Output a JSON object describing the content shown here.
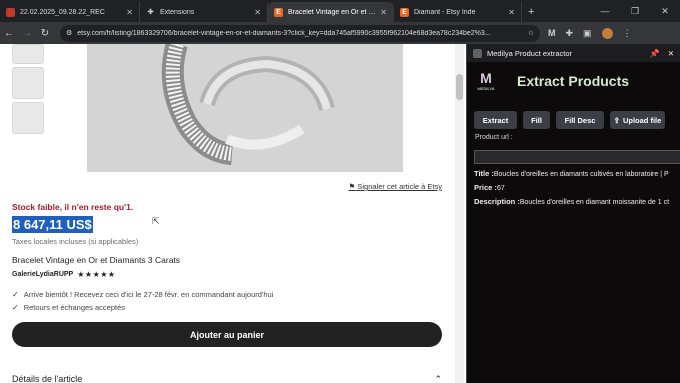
{
  "tabs": [
    {
      "title": "22.02.2025_09.28.22_REC",
      "icon": "video-icon",
      "color": "#c0392b",
      "active": false
    },
    {
      "title": "Extensions",
      "icon": "puzzle-icon",
      "color": "#5f6368",
      "active": false
    },
    {
      "title": "Bracelet Vintage en Or et Diam...",
      "icon": "etsy-icon",
      "color": "#f1641e",
      "active": true
    },
    {
      "title": "Diamant - Etsy Inde",
      "icon": "etsy-icon",
      "color": "#f1641e",
      "active": false
    }
  ],
  "tab_favicon_letters": {
    "etsy": "E"
  },
  "window_controls": {
    "minimize": "—",
    "maximize": "❐",
    "close": "✕"
  },
  "url": "etsy.com/fr/listing/1863329706/bracelet-vintage-en-or-et-diamants-3?click_key=dda745af5990c3955f962104e68d3ea78c234be2%3...",
  "listing": {
    "report_link": "Signaler cet article à Etsy",
    "stock_warning": "Stock faible, il n'en reste qu'1.",
    "price": "8 647,11 US$",
    "tax_note": "Taxes locales incluses (si applicables)",
    "title": "Bracelet Vintage en Or et Diamants 3 Carats",
    "shop_name": "GalerieLydiaRUPP",
    "stars": "★★★★★",
    "delivery": "Arrive bientôt ! Recevez ceci d'ici le 27-28 févr. en commandant aujourd'hui",
    "returns": "Retours et échanges acceptés",
    "add_to_cart": "Ajouter au panier",
    "details_header": "Détails de l'article"
  },
  "extension": {
    "header_title": "Medilya Product extractor",
    "logo_letters": "M",
    "logo_label": "MEDILYA",
    "title": "Extract Products",
    "buttons": [
      "Extract",
      "Fill",
      "Fill Desc",
      "Upload file"
    ],
    "product_url_label": "Product url :",
    "product_url_value": "",
    "title_label": "Title :",
    "title_value": "Boucles d'oreilles en diamants cultivés en laboratoire | P",
    "price_label": "Price :",
    "price_value": "67",
    "description_label": "Description :",
    "description_value": "Boucles d'oreilles en diamant moissanite de 1 ct"
  }
}
